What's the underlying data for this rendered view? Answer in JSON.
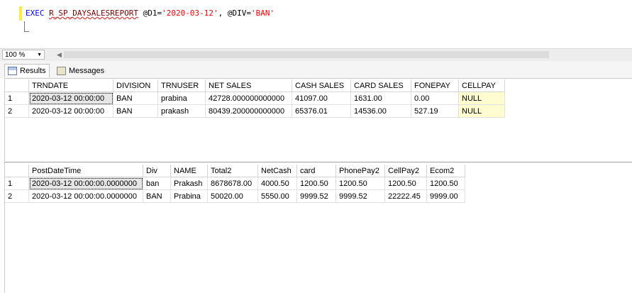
{
  "editor": {
    "exec": "EXEC",
    "proc": "R_SP_DAYSALESREPORT",
    "param1_name": " @D1=",
    "param1_value": "'2020-03-12'",
    "sep": ", ",
    "param2_name": "@DIV=",
    "param2_value": "'BAN'"
  },
  "zoom": {
    "value": "100 %"
  },
  "tabs": [
    {
      "label": "Results",
      "icon": "grid-icon"
    },
    {
      "label": "Messages",
      "icon": "messages-icon"
    }
  ],
  "grid1": {
    "headers": [
      "TRNDATE",
      "DIVISION",
      "TRNUSER",
      "NET SALES",
      "CASH SALES",
      "CARD SALES",
      "FONEPAY",
      "CELLPAY"
    ],
    "rows": [
      {
        "num": "1",
        "cells": [
          "2020-03-12 00:00:00",
          "BAN",
          "prabina",
          "42728.000000000000",
          "41097.00",
          "1631.00",
          "0.00",
          "NULL"
        ]
      },
      {
        "num": "2",
        "cells": [
          "2020-03-12 00:00:00",
          "BAN",
          "prakash",
          "80439.200000000000",
          "65376.01",
          "14536.00",
          "527.19",
          "NULL"
        ]
      }
    ]
  },
  "grid2": {
    "headers": [
      "PostDateTime",
      "Div",
      "NAME",
      "Total2",
      "NetCash",
      "card",
      "PhonePay2",
      "CellPay2",
      "Ecom2"
    ],
    "rows": [
      {
        "num": "1",
        "cells": [
          "2020-03-12 00:00:00.0000000",
          "ban",
          "Prakash",
          "8678678.00",
          "4000.50",
          "1200.50",
          "1200.50",
          "1200.50",
          "1200.50"
        ]
      },
      {
        "num": "2",
        "cells": [
          "2020-03-12 00:00:00.0000000",
          "BAN",
          "Prabina",
          "50020.00",
          "5550.00",
          "9999.52",
          "9999.52",
          "22222.45",
          "9999.00"
        ]
      }
    ]
  }
}
